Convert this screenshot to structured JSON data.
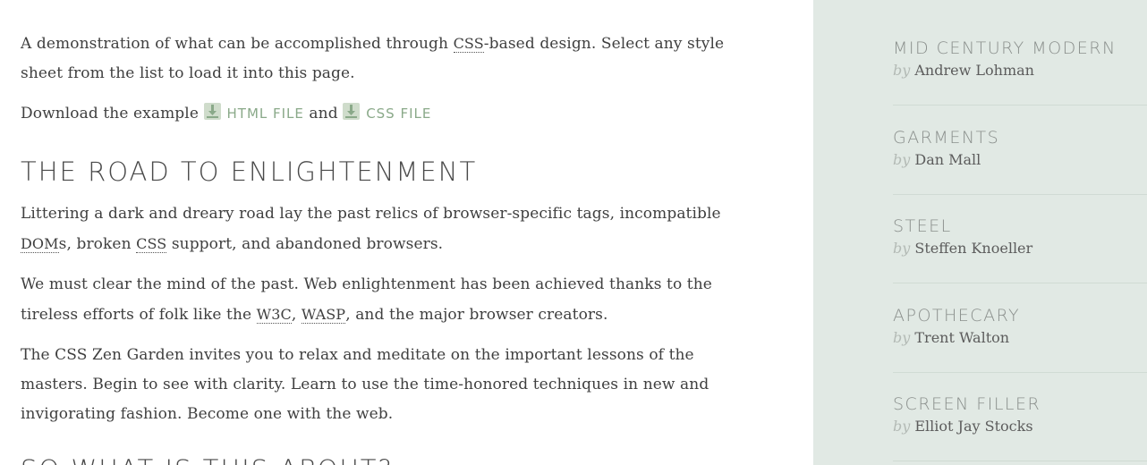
{
  "intro": {
    "p1_before": "A demonstration of what can be accomplished through ",
    "p1_abbr": "CSS",
    "p1_after": "-based design. Select any style sheet from the list to load it into this page.",
    "p2_before": "Download the example ",
    "html_file_label": "HTML FILE",
    "p2_and": " and ",
    "css_file_label": "CSS FILE"
  },
  "section1": {
    "heading": "THE ROAD TO ENLIGHTENMENT",
    "p1_before": "Littering a dark and dreary road lay the past relics of browser-specific tags, incompatible ",
    "p1_abbr_dom": "DOM",
    "p1_mid": "s, broken ",
    "p1_abbr_css": "CSS",
    "p1_after": " support, and abandoned browsers.",
    "p2_before": "We must clear the mind of the past. Web enlightenment has been achieved thanks to the tireless efforts of folk like the ",
    "p2_abbr_w3c": "W3C",
    "p2_comma": ", ",
    "p2_abbr_wasp": "WASP",
    "p2_after": ", and the major browser creators.",
    "p3": "The CSS Zen Garden invites you to relax and meditate on the important lessons of the masters. Begin to see with clarity. Learn to use the time-honored techniques in new and invigorating fashion. Become one with the web."
  },
  "section2": {
    "heading": "SO WHAT IS THIS ABOUT?"
  },
  "sidebar": {
    "by_label": "by",
    "designs": [
      {
        "name": "MID CENTURY MODERN",
        "author": "Andrew Lohman"
      },
      {
        "name": "GARMENTS",
        "author": "Dan Mall"
      },
      {
        "name": "STEEL",
        "author": "Steffen Knoeller"
      },
      {
        "name": "APOTHECARY",
        "author": "Trent Walton"
      },
      {
        "name": "SCREEN FILLER",
        "author": "Elliot Jay Stocks"
      }
    ]
  }
}
